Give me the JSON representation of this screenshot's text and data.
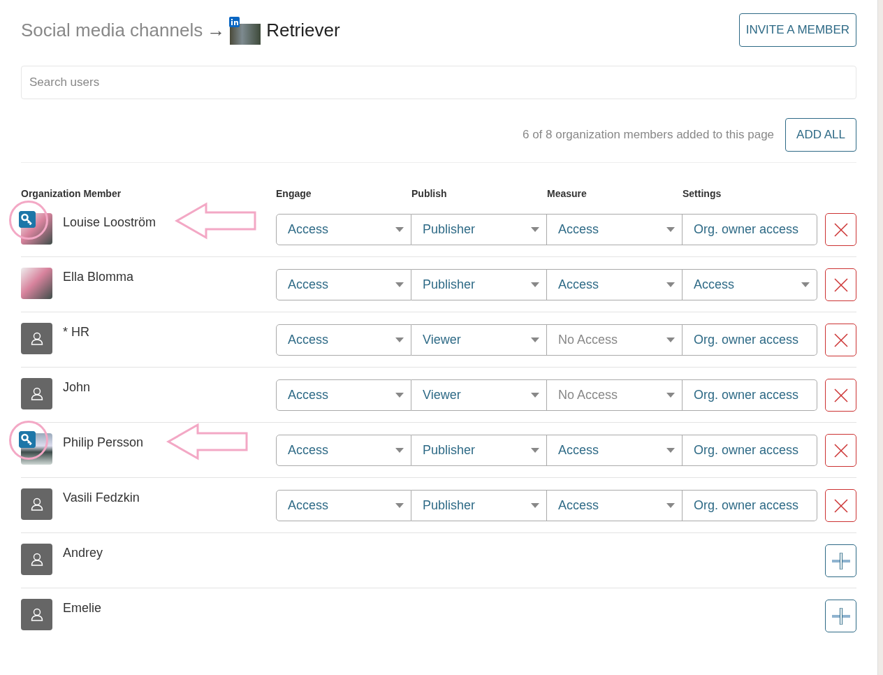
{
  "breadcrumb": {
    "parent": "Social media channels",
    "separator": "→",
    "channel": "Retriever"
  },
  "invite_button": "INVITE A MEMBER",
  "search": {
    "placeholder": "Search users"
  },
  "summary": {
    "text": "6 of 8 organization members added to this page",
    "button": "ADD ALL"
  },
  "columns": [
    "Organization Member",
    "Engage",
    "Publish",
    "Measure",
    "Settings"
  ],
  "members": [
    {
      "name": "Louise Looström",
      "kind": "photo",
      "admin": true,
      "highlighted": true,
      "added": true,
      "roles": [
        {
          "value": "Access",
          "dropdown": true,
          "disabled": false
        },
        {
          "value": "Publisher",
          "dropdown": true,
          "disabled": false
        },
        {
          "value": "Access",
          "dropdown": true,
          "disabled": false
        },
        {
          "value": "Org. owner access",
          "dropdown": false,
          "disabled": false
        }
      ]
    },
    {
      "name": "Ella Blomma",
      "kind": "photo",
      "admin": false,
      "highlighted": false,
      "added": true,
      "roles": [
        {
          "value": "Access",
          "dropdown": true,
          "disabled": false
        },
        {
          "value": "Publisher",
          "dropdown": true,
          "disabled": false
        },
        {
          "value": "Access",
          "dropdown": true,
          "disabled": false
        },
        {
          "value": "Access",
          "dropdown": true,
          "disabled": false
        }
      ]
    },
    {
      "name": "* HR",
      "kind": "default",
      "admin": false,
      "highlighted": false,
      "added": true,
      "roles": [
        {
          "value": "Access",
          "dropdown": true,
          "disabled": false
        },
        {
          "value": "Viewer",
          "dropdown": true,
          "disabled": false
        },
        {
          "value": "No Access",
          "dropdown": true,
          "disabled": true
        },
        {
          "value": "Org. owner access",
          "dropdown": false,
          "disabled": false
        }
      ]
    },
    {
      "name": "John",
      "kind": "default",
      "admin": false,
      "highlighted": false,
      "added": true,
      "roles": [
        {
          "value": "Access",
          "dropdown": true,
          "disabled": false
        },
        {
          "value": "Viewer",
          "dropdown": true,
          "disabled": false
        },
        {
          "value": "No Access",
          "dropdown": true,
          "disabled": true
        },
        {
          "value": "Org. owner access",
          "dropdown": false,
          "disabled": false
        }
      ]
    },
    {
      "name": "Philip Persson",
      "kind": "photo",
      "admin": true,
      "highlighted": true,
      "added": true,
      "roles": [
        {
          "value": "Access",
          "dropdown": true,
          "disabled": false
        },
        {
          "value": "Publisher",
          "dropdown": true,
          "disabled": false
        },
        {
          "value": "Access",
          "dropdown": true,
          "disabled": false
        },
        {
          "value": "Org. owner access",
          "dropdown": false,
          "disabled": false
        }
      ]
    },
    {
      "name": "Vasili Fedzkin",
      "kind": "default",
      "admin": false,
      "highlighted": false,
      "added": true,
      "roles": [
        {
          "value": "Access",
          "dropdown": true,
          "disabled": false
        },
        {
          "value": "Publisher",
          "dropdown": true,
          "disabled": false
        },
        {
          "value": "Access",
          "dropdown": true,
          "disabled": false
        },
        {
          "value": "Org. owner access",
          "dropdown": false,
          "disabled": false
        }
      ]
    },
    {
      "name": "Andrey",
      "kind": "default",
      "admin": false,
      "highlighted": false,
      "added": false
    },
    {
      "name": "Emelie",
      "kind": "default",
      "admin": false,
      "highlighted": false,
      "added": false
    }
  ]
}
